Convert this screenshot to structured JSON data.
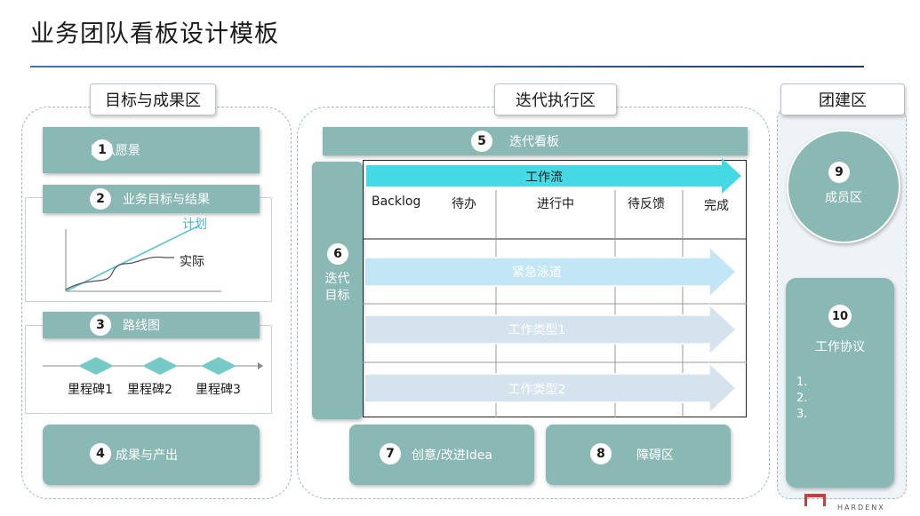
{
  "title": "业务团队看板设计模板",
  "zones": {
    "goals": "目标与成果区",
    "iteration": "迭代执行区",
    "team": "团建区"
  },
  "items": {
    "vision": {
      "num": "1",
      "label": "团队愿景"
    },
    "business": {
      "num": "2",
      "label": "业务目标与结果"
    },
    "roadmap": {
      "num": "3",
      "label": "路线图"
    },
    "outcome": {
      "num": "4",
      "label": "成果与产出"
    },
    "kanban": {
      "num": "5",
      "label": "迭代看板"
    },
    "iter_goal": {
      "num": "6",
      "label_line1": "迭代",
      "label_line2": "目标"
    },
    "idea": {
      "num": "7",
      "label": "创意/改进Idea"
    },
    "blocker": {
      "num": "8",
      "label": "障碍区"
    },
    "members": {
      "num": "9",
      "label": "成员区"
    },
    "agreement": {
      "num": "10",
      "label": "工作协议",
      "lines": [
        "1.",
        "2.",
        "3."
      ]
    }
  },
  "chart": {
    "plan": "计划",
    "actual": "实际"
  },
  "milestones": [
    "里程碑1",
    "里程碑2",
    "里程碑3"
  ],
  "board": {
    "workflow": "工作流",
    "columns": [
      "Backlog",
      "待办",
      "进行中",
      "待反馈",
      "完成"
    ],
    "lanes": [
      "紧急泳道",
      "工作类型1",
      "工作类型2"
    ]
  },
  "colors": {
    "teal": "#8ab8b4",
    "cyan": "#45d9e6",
    "lane": "#d4e3ee",
    "urgent": "#c2e6f6"
  },
  "logo": {
    "text": "HARDENX"
  }
}
